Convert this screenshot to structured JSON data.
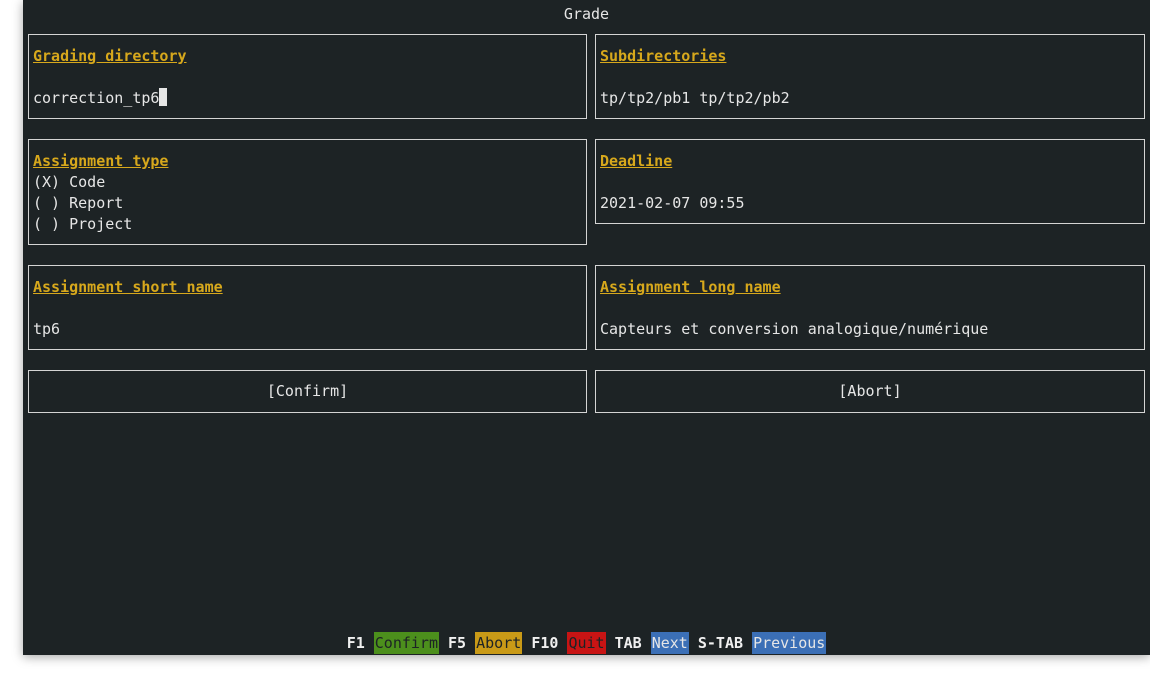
{
  "window": {
    "title": "Grade"
  },
  "fields": {
    "grading_directory": {
      "label": "Grading directory",
      "value": "correction_tp6"
    },
    "subdirectories": {
      "label": "Subdirectories",
      "value": "tp/tp2/pb1 tp/tp2/pb2"
    },
    "assignment_type": {
      "label": "Assignment type",
      "options": [
        {
          "text": "(X) Code"
        },
        {
          "text": "( ) Report"
        },
        {
          "text": "( ) Project"
        }
      ],
      "selected": "Code"
    },
    "deadline": {
      "label": "Deadline",
      "value": "2021-02-07 09:55"
    },
    "short_name": {
      "label": "Assignment short name",
      "value": "tp6"
    },
    "long_name": {
      "label": "Assignment long name",
      "value": "Capteurs et conversion analogique/numérique"
    }
  },
  "buttons": {
    "confirm": "[Confirm]",
    "abort": "[Abort]"
  },
  "footer": {
    "items": [
      {
        "key": "F1",
        "action": "Confirm",
        "color": "#4c8f1c"
      },
      {
        "key": "F5",
        "action": "Abort",
        "color": "#c99a17"
      },
      {
        "key": "F10",
        "action": "Quit",
        "color": "#c81414"
      },
      {
        "key": "TAB",
        "action": "Next",
        "color": "#3b6fb6"
      },
      {
        "key": "S-TAB",
        "action": "Previous",
        "color": "#3b6fb6"
      }
    ]
  }
}
